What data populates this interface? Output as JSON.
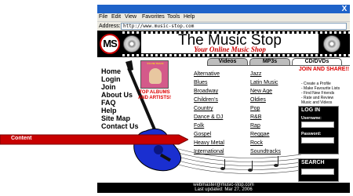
{
  "browser": {
    "close_glyph": "X",
    "menu": [
      "File",
      "Edit",
      "View",
      "Favorites",
      "Tools",
      "Help"
    ],
    "address_label": "Address:",
    "address_value": "http://www.music-stop.com"
  },
  "site": {
    "logo_text": "MS",
    "title": "The Music Stop",
    "tagline": "Your Online Music Shop"
  },
  "tabs": [
    {
      "label": "Videos",
      "active": false
    },
    {
      "label": "MP3s",
      "active": false
    },
    {
      "label": "CD/DVDs",
      "active": true
    }
  ],
  "left_nav": [
    "Home",
    "Login",
    "Join",
    "About Us",
    "FAQ",
    "Help",
    "Site Map",
    "Contact Us"
  ],
  "promo": {
    "album_caption": "SYLVIE TRACK",
    "text": "TOP ALBUMS AND ARTISTS!"
  },
  "genres": {
    "col1": [
      "Alternative",
      "Blues",
      "Broadway",
      "Children's",
      "Country",
      "Dance & DJ",
      "Folk",
      "Gospel",
      "Heavy Metal",
      "International"
    ],
    "col2": [
      "Jazz",
      "Latin Music",
      "New Age",
      "Oldies",
      "Pop",
      "R&B",
      "Rap",
      "Reggae",
      "Rock",
      "Soundtracks"
    ]
  },
  "join": {
    "title": "JOIN AND SHARE!!",
    "items": [
      "- Create a Profile",
      "- Make Favourite Lists",
      "- Find New Friends",
      "- Rate and Review",
      "  Music and Videos"
    ]
  },
  "login": {
    "title": "LOG IN",
    "username_label": "Username:",
    "password_label": "Password:"
  },
  "search": {
    "title": "SEARCH"
  },
  "footer": {
    "email": "webmaster@music-stop.com",
    "updated": "Last updated: Mar 27, 2006"
  },
  "annotation": {
    "label": "Content"
  },
  "colors": {
    "accent_red": "#d00000",
    "titlebar_blue": "#1f63c9",
    "guitar_blue": "#1a2fd0"
  }
}
